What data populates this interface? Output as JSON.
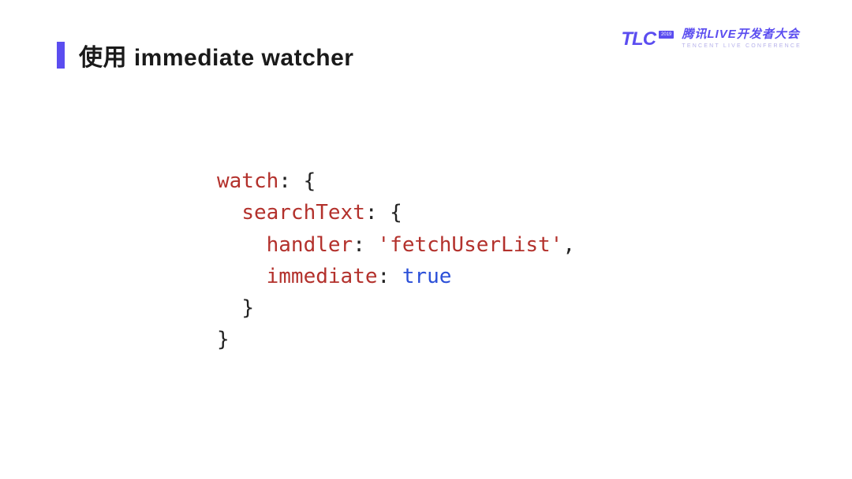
{
  "slide": {
    "title": "使用 immediate watcher"
  },
  "logo": {
    "abbr": "TLC",
    "badge_year": "2019",
    "title_cn": "腾讯LIVE开发者大会",
    "title_en": "TENCENT LIVE CONFERENCE"
  },
  "code": {
    "l1_k": "watch",
    "l1_p": ": {",
    "l2_k": "searchText",
    "l2_p": ": {",
    "l3_k": "handler",
    "l3_p1": ": ",
    "l3_s": "'fetchUserList'",
    "l3_p2": ",",
    "l4_k": "immediate",
    "l4_p1": ": ",
    "l4_b": "true",
    "l5_p": "}",
    "l6_p": "}"
  }
}
